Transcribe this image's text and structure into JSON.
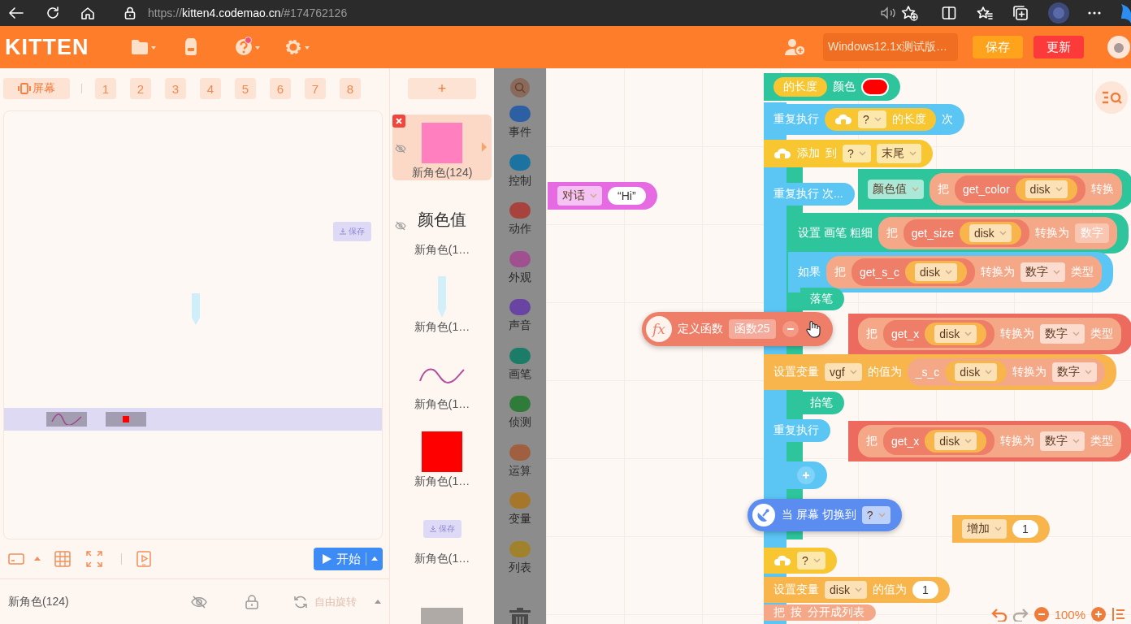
{
  "browser": {
    "url_scheme": "https://",
    "url_host": "kitten4.codemao.cn",
    "url_path": "/#174762126"
  },
  "header": {
    "logo": "KITTEN",
    "help_notification": true,
    "project_title": "Windows12.1x测试版…",
    "save": "保存",
    "update": "更新"
  },
  "screen_tabs": {
    "screen": "屏幕",
    "numbers": [
      "1",
      "2",
      "3",
      "4",
      "5",
      "6",
      "7",
      "8"
    ]
  },
  "stage": {
    "save_chip": "保存"
  },
  "stage_toolbar": {
    "start": "开始"
  },
  "sprite_info": {
    "name": "新角色(124)",
    "rotation": "自由旋转",
    "rotation_disabled": true
  },
  "sprites": {
    "add": "+",
    "items": [
      {
        "name": "新角色(124)",
        "kind": "square",
        "color": "#ff7fbf",
        "selected": true,
        "hidden": true
      },
      {
        "name": "新角色(1…",
        "kind": "text",
        "thumb_text": "颜色值",
        "selected": false,
        "hidden": true
      },
      {
        "name": "新角色(1…",
        "kind": "pencil",
        "selected": false,
        "hidden": false
      },
      {
        "name": "新角色(1…",
        "kind": "wave",
        "selected": false,
        "hidden": false
      },
      {
        "name": "新角色(1…",
        "kind": "square",
        "color": "#ff0000",
        "selected": false,
        "hidden": false
      },
      {
        "name": "新角色(1…",
        "kind": "button",
        "thumb_text": "保存",
        "selected": false,
        "hidden": false
      },
      {
        "kind": "bar",
        "color": "#b0aaa6",
        "selected": false,
        "hidden": false
      }
    ]
  },
  "categories": {
    "items": [
      {
        "label": "事件",
        "color": "#2d5fa5"
      },
      {
        "label": "控制",
        "color": "#1c72a0"
      },
      {
        "label": "动作",
        "color": "#a8423c"
      },
      {
        "label": "外观",
        "color": "#a0508f"
      },
      {
        "label": "声音",
        "color": "#6a44a3"
      },
      {
        "label": "画笔",
        "color": "#1b7d68"
      },
      {
        "label": "侦测",
        "color": "#2f7b3a"
      },
      {
        "label": "运算",
        "color": "#a0603f"
      },
      {
        "label": "变量",
        "color": "#a6772a"
      },
      {
        "label": "列表",
        "color": "#a1822c"
      }
    ]
  },
  "canvas": {
    "zoom": "100%",
    "arms": [
      {
        "kind": "control"
      },
      {
        "kind": "pen"
      }
    ],
    "blocks": [
      {
        "kind": "pen",
        "parts": [
          {
            "kind": "list",
            "parts": [
              {
                "kind": "text",
                "text": "的长度"
              }
            ]
          },
          {
            "kind": "text",
            "text": "颜色"
          },
          {
            "kind": "swatch",
            "color": "#ff0000"
          }
        ]
      },
      {
        "kind": "control",
        "parts": [
          {
            "kind": "text",
            "text": "重复执行"
          },
          {
            "kind": "list",
            "parts": [
              {
                "kind": "list_icon"
              },
              {
                "kind": "dropdown",
                "text": "?"
              },
              {
                "kind": "text",
                "text": "的长度"
              }
            ]
          },
          {
            "kind": "text",
            "text": "次"
          }
        ]
      },
      {
        "kind": "list",
        "parts": [
          {
            "kind": "list_icon"
          },
          {
            "kind": "text",
            "text": "添加"
          },
          {
            "kind": "text",
            "text": "到"
          },
          {
            "kind": "dropdown",
            "text": "?"
          },
          {
            "kind": "dropdown",
            "text": "末尾"
          }
        ]
      },
      {
        "kind": "dialog",
        "parts": [
          {
            "kind": "dropdown",
            "text": "对话"
          },
          {
            "kind": "input",
            "text": "“Hi”"
          }
        ]
      },
      {
        "kind": "control",
        "parts": [
          {
            "kind": "text",
            "text": "重复执行 次..."
          }
        ]
      },
      {
        "kind": "pen",
        "parts": [
          {
            "kind": "dropdown",
            "text": "颜色值"
          },
          {
            "kind": "operator",
            "parts": [
              {
                "kind": "text",
                "text": "把"
              },
              {
                "kind": "function",
                "parts": [
                  {
                    "kind": "text",
                    "text": "get_color"
                  },
                  {
                    "kind": "data",
                    "parts": [
                      {
                        "kind": "dropdown",
                        "text": "disk"
                      }
                    ]
                  }
                ]
              },
              {
                "kind": "text",
                "text": "转换"
              }
            ]
          }
        ]
      },
      {
        "kind": "pen",
        "parts": [
          {
            "kind": "text",
            "text": "设置 画笔 粗细"
          },
          {
            "kind": "operator",
            "parts": [
              {
                "kind": "text",
                "text": "把"
              },
              {
                "kind": "function",
                "parts": [
                  {
                    "kind": "text",
                    "text": "get_size"
                  },
                  {
                    "kind": "data",
                    "parts": [
                      {
                        "kind": "dropdown",
                        "text": "disk"
                      }
                    ]
                  }
                ]
              },
              {
                "kind": "text",
                "text": "转换为"
              },
              {
                "kind": "chip",
                "text": "数字"
              }
            ]
          }
        ]
      },
      {
        "kind": "control",
        "parts": [
          {
            "kind": "text",
            "text": "如果"
          },
          {
            "kind": "operator",
            "parts": [
              {
                "kind": "text",
                "text": "把"
              },
              {
                "kind": "function",
                "parts": [
                  {
                    "kind": "text",
                    "text": "get_s_c"
                  },
                  {
                    "kind": "data",
                    "parts": [
                      {
                        "kind": "dropdown",
                        "text": "disk"
                      }
                    ]
                  }
                ]
              },
              {
                "kind": "text",
                "text": "转换为"
              },
              {
                "kind": "dropdown",
                "text": "数字"
              },
              {
                "kind": "text",
                "text": "类型"
              }
            ]
          }
        ]
      },
      {
        "kind": "pen",
        "parts": [
          {
            "kind": "text",
            "text": "落笔"
          }
        ]
      },
      {
        "kind": "function",
        "parts": [
          {
            "kind": "fx_badge",
            "text": "fx"
          },
          {
            "kind": "text",
            "text": "定义函数"
          },
          {
            "kind": "chip",
            "text": "函数25"
          },
          {
            "kind": "minus_button"
          },
          {
            "kind": "hand_cursor"
          }
        ]
      },
      {
        "kind": "motion",
        "parts": [
          {
            "kind": "operator",
            "parts": [
              {
                "kind": "text",
                "text": "把"
              },
              {
                "kind": "function",
                "parts": [
                  {
                    "kind": "text",
                    "text": "get_x"
                  },
                  {
                    "kind": "data",
                    "parts": [
                      {
                        "kind": "dropdown",
                        "text": "disk"
                      }
                    ]
                  }
                ]
              },
              {
                "kind": "text",
                "text": "转换为"
              },
              {
                "kind": "dropdown",
                "text": "数字"
              },
              {
                "kind": "text",
                "text": "类型"
              }
            ]
          }
        ]
      },
      {
        "kind": "data",
        "parts": [
          {
            "kind": "text",
            "text": "设置变量"
          },
          {
            "kind": "dropdown",
            "text": "vgf"
          },
          {
            "kind": "text",
            "text": "的值为"
          },
          {
            "kind": "operator",
            "parts": [
              {
                "kind": "text",
                "text": "_s_c"
              },
              {
                "kind": "data",
                "parts": [
                  {
                    "kind": "dropdown",
                    "text": "disk"
                  }
                ]
              },
              {
                "kind": "text",
                "text": "转换为"
              },
              {
                "kind": "dropdown",
                "text": "数字"
              }
            ]
          }
        ]
      },
      {
        "kind": "pen",
        "parts": [
          {
            "kind": "text",
            "text": "抬笔"
          }
        ]
      },
      {
        "kind": "control",
        "parts": [
          {
            "kind": "text",
            "text": "重复执行"
          }
        ]
      },
      {
        "kind": "motion",
        "parts": [
          {
            "kind": "operator",
            "parts": [
              {
                "kind": "text",
                "text": "把"
              },
              {
                "kind": "function",
                "parts": [
                  {
                    "kind": "text",
                    "text": "get_x"
                  },
                  {
                    "kind": "data",
                    "parts": [
                      {
                        "kind": "dropdown",
                        "text": "disk"
                      }
                    ]
                  }
                ]
              },
              {
                "kind": "text",
                "text": "转换为"
              },
              {
                "kind": "dropdown",
                "text": "数字"
              },
              {
                "kind": "text",
                "text": "类型"
              }
            ]
          }
        ]
      },
      {
        "kind": "control",
        "parts": [
          {
            "kind": "plus_button"
          }
        ]
      },
      {
        "kind": "event",
        "parts": [
          {
            "kind": "event_icon"
          },
          {
            "kind": "text",
            "text": "当 屏幕 切换到"
          },
          {
            "kind": "dropdown",
            "text": "?"
          }
        ]
      },
      {
        "kind": "data",
        "parts": [
          {
            "kind": "dropdown",
            "text": "增加"
          },
          {
            "kind": "input",
            "text": "1"
          }
        ]
      },
      {
        "kind": "list",
        "parts": [
          {
            "kind": "list_icon"
          },
          {
            "kind": "dropdown",
            "text": "?"
          }
        ]
      },
      {
        "kind": "data",
        "parts": [
          {
            "kind": "text",
            "text": "设置变量"
          },
          {
            "kind": "dropdown",
            "text": "disk"
          },
          {
            "kind": "text",
            "text": "的值为"
          },
          {
            "kind": "input",
            "text": "1"
          }
        ]
      },
      {
        "kind": "operator",
        "parts": [
          {
            "kind": "text",
            "text": "把"
          },
          {
            "kind": "text",
            "text": "按"
          },
          {
            "kind": "text",
            "text": "分开成列表"
          }
        ]
      }
    ]
  }
}
